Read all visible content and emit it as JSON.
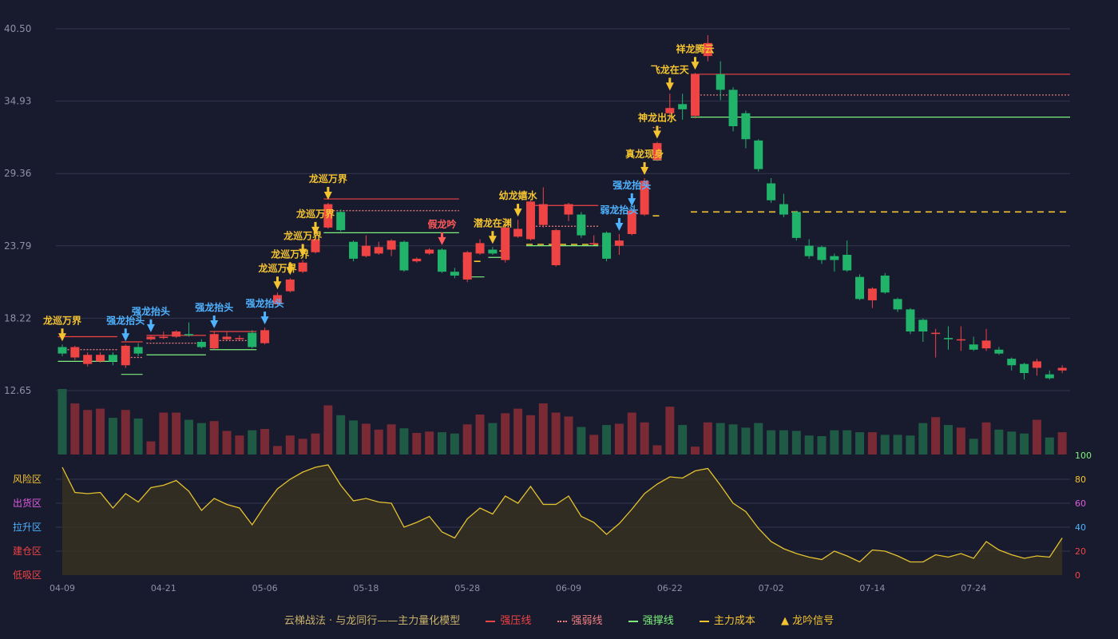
{
  "chart_data": {
    "type": "candlestick",
    "price_axis": {
      "ticks": [
        "40.50",
        "34.93",
        "29.36",
        "23.79",
        "18.22",
        "12.65"
      ],
      "range": [
        12.65,
        40.5
      ]
    },
    "osc_axis": {
      "ticks": [
        "0",
        "20",
        "40",
        "60",
        "80",
        "100"
      ],
      "range": [
        0,
        100
      ],
      "zones": [
        "风险区",
        "出货区",
        "拉升区",
        "建仓区",
        "低吸区"
      ]
    },
    "date_labels": [
      {
        "i": 0,
        "text": "04-09"
      },
      {
        "i": 8,
        "text": "04-21"
      },
      {
        "i": 16,
        "text": "05-06"
      },
      {
        "i": 24,
        "text": "05-18"
      },
      {
        "i": 32,
        "text": "05-28"
      },
      {
        "i": 40,
        "text": "06-09"
      },
      {
        "i": 48,
        "text": "06-22"
      },
      {
        "i": 56,
        "text": "07-02"
      },
      {
        "i": 64,
        "text": "07-14"
      },
      {
        "i": 72,
        "text": "07-24"
      }
    ],
    "candles": [
      [
        16.0,
        15.5,
        16.2,
        15.3
      ],
      [
        15.2,
        16.0,
        16.1,
        15.0
      ],
      [
        14.7,
        15.4,
        15.6,
        14.5
      ],
      [
        14.9,
        15.4,
        15.6,
        14.8
      ],
      [
        15.4,
        14.9,
        15.6,
        14.6
      ],
      [
        14.6,
        16.1,
        16.2,
        14.4
      ],
      [
        16.0,
        15.5,
        16.3,
        15.3
      ],
      [
        16.6,
        16.8,
        16.9,
        16.5
      ],
      [
        16.7,
        16.8,
        17.2,
        16.6
      ],
      [
        16.8,
        17.2,
        17.3,
        16.7
      ],
      [
        17.0,
        16.9,
        17.9,
        16.8
      ],
      [
        16.4,
        16.0,
        16.6,
        15.9
      ],
      [
        15.9,
        17.0,
        17.2,
        15.8
      ],
      [
        16.6,
        16.8,
        17.2,
        16.5
      ],
      [
        16.7,
        16.7,
        16.9,
        16.5
      ],
      [
        17.1,
        16.0,
        17.3,
        15.9
      ],
      [
        16.3,
        17.3,
        17.5,
        16.2
      ],
      [
        19.3,
        20.0,
        20.2,
        19.2
      ],
      [
        20.3,
        21.2,
        21.3,
        20.2
      ],
      [
        21.8,
        22.5,
        22.7,
        21.7
      ],
      [
        23.3,
        24.3,
        24.4,
        23.2
      ],
      [
        25.2,
        27.0,
        27.1,
        25.1
      ],
      [
        26.4,
        25.0,
        26.6,
        24.9
      ],
      [
        24.1,
        22.8,
        24.2,
        22.6
      ],
      [
        23.0,
        23.8,
        24.6,
        22.9
      ],
      [
        23.2,
        23.7,
        24.1,
        23.1
      ],
      [
        23.5,
        24.2,
        24.3,
        23.0
      ],
      [
        24.1,
        21.9,
        24.2,
        21.8
      ],
      [
        22.6,
        22.8,
        22.9,
        22.5
      ],
      [
        23.2,
        23.5,
        23.6,
        23.1
      ],
      [
        23.5,
        21.8,
        23.6,
        21.7
      ],
      [
        21.8,
        21.5,
        22.1,
        21.3
      ],
      [
        21.2,
        23.3,
        23.4,
        21.0
      ],
      [
        23.2,
        24.0,
        24.3,
        23.1
      ],
      [
        23.5,
        23.2,
        23.7,
        23.1
      ],
      [
        22.7,
        25.2,
        25.4,
        22.5
      ],
      [
        24.5,
        25.1,
        25.8,
        24.4
      ],
      [
        24.3,
        27.2,
        27.3,
        24.2
      ],
      [
        25.4,
        27.0,
        28.3,
        25.2
      ],
      [
        22.3,
        25.0,
        25.1,
        22.2
      ],
      [
        26.2,
        27.0,
        27.1,
        25.7
      ],
      [
        26.2,
        24.6,
        26.4,
        24.4
      ],
      [
        24.0,
        24.0,
        24.6,
        23.9
      ],
      [
        24.8,
        22.8,
        24.9,
        22.6
      ],
      [
        23.8,
        24.2,
        24.7,
        23.1
      ],
      [
        24.7,
        26.5,
        26.6,
        24.6
      ],
      [
        26.2,
        28.8,
        29.0,
        26.1
      ],
      [
        30.4,
        31.7,
        31.8,
        30.3
      ],
      [
        34.0,
        34.4,
        35.5,
        33.8
      ],
      [
        34.7,
        34.3,
        35.5,
        33.5
      ],
      [
        33.8,
        37.0,
        37.1,
        33.6
      ],
      [
        38.4,
        39.4,
        40.0,
        38.0
      ],
      [
        37.0,
        35.8,
        38.0,
        35.0
      ],
      [
        35.8,
        33.0,
        36.0,
        32.6
      ],
      [
        34.0,
        32.0,
        34.2,
        31.3
      ],
      [
        31.9,
        29.7,
        32.0,
        29.5
      ],
      [
        28.6,
        27.3,
        29.0,
        27.1
      ],
      [
        27.0,
        26.2,
        27.8,
        26.0
      ],
      [
        26.4,
        24.4,
        26.5,
        24.2
      ],
      [
        23.8,
        23.0,
        24.3,
        22.8
      ],
      [
        23.7,
        22.7,
        23.8,
        22.4
      ],
      [
        23.0,
        22.7,
        23.2,
        21.8
      ],
      [
        23.1,
        21.9,
        24.2,
        21.8
      ],
      [
        21.4,
        19.7,
        21.6,
        19.6
      ],
      [
        19.6,
        20.5,
        20.6,
        19.0
      ],
      [
        21.5,
        20.2,
        21.7,
        20.1
      ],
      [
        19.7,
        18.9,
        19.8,
        18.7
      ],
      [
        18.9,
        17.2,
        19.0,
        17.0
      ],
      [
        18.1,
        17.2,
        18.2,
        16.4
      ],
      [
        17.1,
        17.1,
        17.4,
        15.2
      ],
      [
        16.7,
        16.6,
        17.6,
        15.8
      ],
      [
        16.6,
        16.6,
        17.6,
        15.7
      ],
      [
        16.2,
        15.8,
        16.8,
        15.7
      ],
      [
        15.9,
        16.5,
        17.4,
        15.7
      ],
      [
        15.8,
        15.5,
        16.0,
        15.4
      ],
      [
        15.1,
        14.6,
        15.2,
        14.2
      ],
      [
        14.7,
        14.0,
        14.8,
        13.5
      ],
      [
        14.4,
        14.9,
        15.1,
        13.8
      ],
      [
        13.9,
        13.6,
        14.2,
        13.5
      ],
      [
        14.2,
        14.4,
        14.6,
        14.0
      ]
    ],
    "volume": [
      100,
      78,
      68,
      70,
      56,
      68,
      55,
      20,
      64,
      64,
      53,
      48,
      51,
      36,
      29,
      37,
      39,
      13,
      29,
      24,
      32,
      75,
      60,
      52,
      47,
      38,
      46,
      40,
      33,
      35,
      34,
      32,
      46,
      61,
      48,
      63,
      70,
      60,
      78,
      64,
      58,
      42,
      30,
      45,
      47,
      64,
      49,
      14,
      73,
      45,
      12,
      49,
      48,
      46,
      41,
      48,
      37,
      37,
      36,
      29,
      28,
      37,
      37,
      34,
      34,
      30,
      30,
      29,
      48,
      57,
      45,
      41,
      24,
      49,
      38,
      35,
      32,
      53,
      26,
      34
    ],
    "oscillator": [
      90,
      69,
      68,
      69,
      56,
      68,
      61,
      73,
      75,
      79,
      70,
      54,
      64,
      59,
      56,
      42,
      58,
      72,
      80,
      86,
      90,
      92,
      75,
      62,
      64,
      61,
      60,
      40,
      44,
      49,
      36,
      31,
      47,
      56,
      51,
      66,
      60,
      74,
      59,
      59,
      66,
      49,
      44,
      34,
      43,
      55,
      68,
      76,
      82,
      81,
      87,
      89,
      75,
      60,
      53,
      39,
      28,
      22,
      18,
      15,
      13,
      20,
      16,
      11,
      21,
      20,
      16,
      11,
      11,
      17,
      15,
      18,
      14,
      28,
      21,
      17,
      14,
      16,
      15,
      31
    ],
    "signals": [
      {
        "i": 0,
        "label": "龙巡万界",
        "kind": "gold"
      },
      {
        "i": 5,
        "label": "强龙抬头",
        "kind": "blue"
      },
      {
        "i": 7,
        "label": "强龙抬头",
        "kind": "blue"
      },
      {
        "i": 12,
        "label": "强龙抬头",
        "kind": "blue"
      },
      {
        "i": 16,
        "label": "强龙抬头",
        "kind": "blue"
      },
      {
        "i": 17,
        "label": "龙巡万界",
        "kind": "gold"
      },
      {
        "i": 18,
        "label": "龙巡万界",
        "kind": "gold"
      },
      {
        "i": 19,
        "label": "龙巡万界",
        "kind": "gold"
      },
      {
        "i": 20,
        "label": "龙巡万界",
        "kind": "gold"
      },
      {
        "i": 21,
        "label": "龙巡万界",
        "kind": "gold"
      },
      {
        "i": 30,
        "label": "假龙吟",
        "kind": "red"
      },
      {
        "i": 34,
        "label": "潜龙在渊",
        "kind": "gold"
      },
      {
        "i": 36,
        "label": "幼龙嬉水",
        "kind": "gold"
      },
      {
        "i": 44,
        "label": "弱龙抬头",
        "kind": "blue"
      },
      {
        "i": 45,
        "label": "强龙抬头",
        "kind": "blue"
      },
      {
        "i": 46,
        "label": "真龙现身",
        "kind": "gold"
      },
      {
        "i": 47,
        "label": "神龙出水",
        "kind": "gold"
      },
      {
        "i": 48,
        "label": "飞龙在天",
        "kind": "gold"
      },
      {
        "i": 50,
        "label": "祥龙腾云",
        "kind": "gold"
      }
    ],
    "levels": [
      {
        "kind": "press",
        "from": 0,
        "to": 4,
        "y": 16.8
      },
      {
        "kind": "weak",
        "from": 0,
        "to": 4,
        "y": 15.8
      },
      {
        "kind": "support",
        "from": 0,
        "to": 4,
        "y": 14.9
      },
      {
        "kind": "press",
        "from": 5,
        "to": 6,
        "y": 16.4
      },
      {
        "kind": "weak",
        "from": 5,
        "to": 6,
        "y": 15.2
      },
      {
        "kind": "support",
        "from": 5,
        "to": 6,
        "y": 13.9
      },
      {
        "kind": "press",
        "from": 7,
        "to": 11,
        "y": 16.9
      },
      {
        "kind": "weak",
        "from": 7,
        "to": 11,
        "y": 16.3
      },
      {
        "kind": "support",
        "from": 7,
        "to": 11,
        "y": 15.4
      },
      {
        "kind": "press",
        "from": 12,
        "to": 15,
        "y": 17.2
      },
      {
        "kind": "weak",
        "from": 12,
        "to": 15,
        "y": 16.5
      },
      {
        "kind": "support",
        "from": 12,
        "to": 15,
        "y": 15.8
      },
      {
        "kind": "press",
        "from": 21,
        "to": 31,
        "y": 27.4
      },
      {
        "kind": "weak",
        "from": 21,
        "to": 31,
        "y": 26.5
      },
      {
        "kind": "support",
        "from": 21,
        "to": 31,
        "y": 24.8
      },
      {
        "kind": "support",
        "from": 32,
        "to": 33,
        "y": 21.4
      },
      {
        "kind": "cost",
        "from": 32,
        "to": 33,
        "y": 22.6
      },
      {
        "kind": "support",
        "from": 34,
        "to": 35,
        "y": 22.9
      },
      {
        "kind": "cost",
        "from": 34,
        "to": 35,
        "y": 23.4
      },
      {
        "kind": "press",
        "from": 37,
        "to": 42,
        "y": 26.9
      },
      {
        "kind": "weak",
        "from": 37,
        "to": 42,
        "y": 25.3
      },
      {
        "kind": "support",
        "from": 37,
        "to": 42,
        "y": 23.8
      },
      {
        "kind": "cost",
        "from": 37,
        "to": 42,
        "y": 23.9
      },
      {
        "kind": "support",
        "from": 44,
        "to": 44,
        "y": 23.9
      },
      {
        "kind": "weak",
        "from": 47,
        "to": 47,
        "y": 32.9
      },
      {
        "kind": "support",
        "from": 47,
        "to": 47,
        "y": 30.4
      },
      {
        "kind": "cost",
        "from": 47,
        "to": 47,
        "y": 26.1
      },
      {
        "kind": "press",
        "from": 50,
        "to": 79,
        "y": 37.0
      },
      {
        "kind": "weak",
        "from": 50,
        "to": 79,
        "y": 35.4
      },
      {
        "kind": "support",
        "from": 50,
        "to": 79,
        "y": 33.7
      },
      {
        "kind": "cost",
        "from": 50,
        "to": 79,
        "y": 26.4
      }
    ],
    "legend": {
      "model": "云梯战法 · 与龙同行——主力量化模型",
      "items": [
        {
          "label": "强压线",
          "color": "#ef4444",
          "style": "solid"
        },
        {
          "label": "强弱线",
          "color": "#f08080",
          "style": "dotted"
        },
        {
          "label": "强撑线",
          "color": "#7cf27c",
          "style": "solid"
        },
        {
          "label": "主力成本",
          "color": "#f4c430",
          "style": "dashed"
        },
        {
          "label": "龙吟信号",
          "color": "#f4c430",
          "style": "triangle"
        }
      ]
    },
    "colors": {
      "up": "#ef4444",
      "down": "#22b36b",
      "gold": "#f4c430",
      "blue": "#4fb3ff",
      "red": "#ff5a5a",
      "osc_line": "#e4c230"
    }
  }
}
